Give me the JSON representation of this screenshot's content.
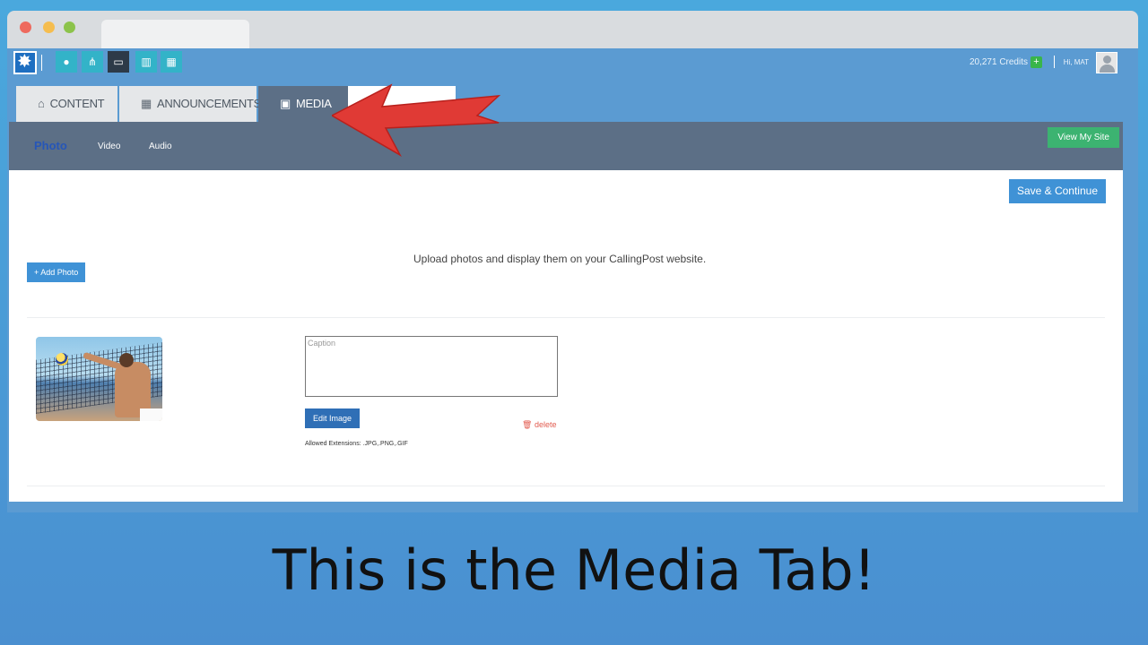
{
  "header": {
    "credits": "20,271 Credits",
    "credits_add": "+",
    "greeting": "Hi, MAT"
  },
  "app_icons": [
    "chat-icon",
    "sitemap-icon",
    "monitor-icon",
    "map-icon",
    "calendar-icon"
  ],
  "nav": {
    "tabs": [
      {
        "label": "Content",
        "icon": "home-icon"
      },
      {
        "label": "Announcements",
        "icon": "calendar-icon"
      },
      {
        "label": "Media",
        "icon": "image-icon",
        "active": true
      }
    ]
  },
  "subnav": {
    "items": [
      "Photo",
      "Video",
      "Audio"
    ],
    "active": "Photo",
    "view_site": "View My Site"
  },
  "panel": {
    "save_label": "Save & Continue",
    "upload_text": "Upload photos and display them on your CallingPost website.",
    "add_photo": "+ Add Photo",
    "caption_placeholder": "Caption",
    "edit_image": "Edit Image",
    "delete": "delete",
    "allowed_extensions": "Allowed Extensions: .JPG,.PNG,.GIF"
  },
  "overlay": {
    "caption": "This is the Media Tab!",
    "arrow_color": "#e03a35"
  },
  "colors": {
    "accent": "#3f92d6",
    "nav_active": "#5c6f86",
    "success": "#3cb371"
  }
}
